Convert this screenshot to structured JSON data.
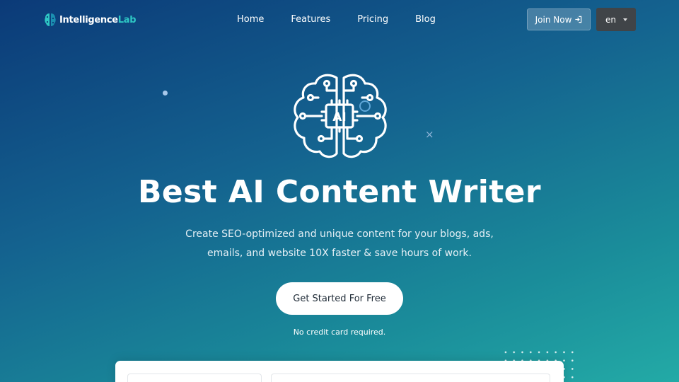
{
  "nav": {
    "logo_main": "Intelligence",
    "logo_accent": "Lab",
    "links": [
      "Home",
      "Features",
      "Pricing",
      "Blog"
    ],
    "join_label": "Join Now",
    "language": "en"
  },
  "hero": {
    "icon_text": "AI",
    "title": "Best AI Content Writer",
    "subtitle_line1": "Create SEO-optimized and unique content for your blogs, ads,",
    "subtitle_line2": "emails, and website 10X faster & save hours of work.",
    "cta_label": "Get Started For Free",
    "note": "No credit card required."
  },
  "decor": {
    "close_glyph": "×"
  },
  "colors": {
    "accent": "#2ec7c4",
    "bg_top": "#0b3a78",
    "bg_bottom": "#23aaa6",
    "lang_bg": "#404448"
  }
}
